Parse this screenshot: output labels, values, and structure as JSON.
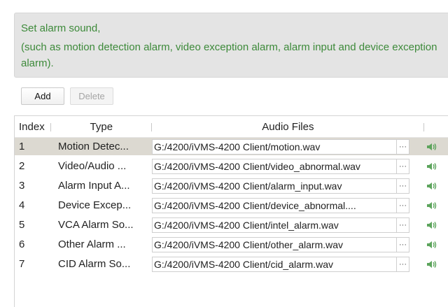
{
  "info": {
    "line1": "Set alarm sound,",
    "line2": "(such as motion detection alarm, video exception alarm, alarm input and device exception alarm)."
  },
  "toolbar": {
    "add_label": "Add",
    "delete_label": "Delete"
  },
  "table": {
    "headers": {
      "index": "Index",
      "type": "Type",
      "files": "Audio Files"
    },
    "browse_label": "···",
    "play_icon": "speaker-icon",
    "rows": [
      {
        "index": "1",
        "type": "Motion Detec...",
        "file": "G:/4200/iVMS-4200 Client/motion.wav",
        "selected": true
      },
      {
        "index": "2",
        "type": "Video/Audio ...",
        "file": "G:/4200/iVMS-4200 Client/video_abnormal.wav",
        "selected": false
      },
      {
        "index": "3",
        "type": "Alarm Input A...",
        "file": "G:/4200/iVMS-4200 Client/alarm_input.wav",
        "selected": false
      },
      {
        "index": "4",
        "type": "Device Excep...",
        "file": "G:/4200/iVMS-4200 Client/device_abnormal....",
        "selected": false
      },
      {
        "index": "5",
        "type": "VCA Alarm So...",
        "file": "G:/4200/iVMS-4200 Client/intel_alarm.wav",
        "selected": false
      },
      {
        "index": "6",
        "type": "Other Alarm ...",
        "file": "G:/4200/iVMS-4200 Client/other_alarm.wav",
        "selected": false
      },
      {
        "index": "7",
        "type": "CID Alarm So...",
        "file": "G:/4200/iVMS-4200 Client/cid_alarm.wav",
        "selected": false
      }
    ]
  },
  "colors": {
    "info_text": "#3d8a3a",
    "selected_row": "#dcd9d1",
    "speaker_icon": "#5ca45c"
  }
}
